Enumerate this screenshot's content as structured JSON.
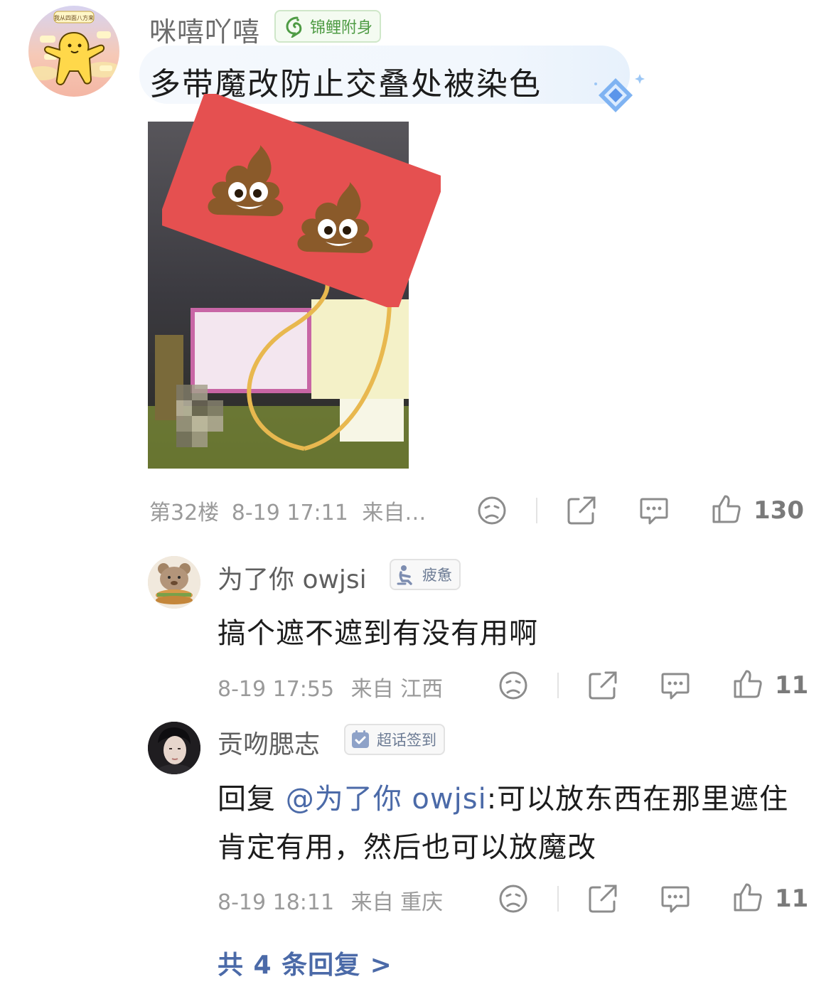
{
  "main_comment": {
    "username": "咪嘻吖嘻",
    "badge": "锦鲤附身",
    "avatar_text": "我从四面八方来",
    "text": "多带魔改防止交叠处被染色",
    "floor": "第32楼",
    "time": "8-19 17:11",
    "source": "来自…",
    "likes": "130"
  },
  "replies": [
    {
      "username": "为了你 owjsi",
      "badge": "疲惫",
      "text": "搞个遮不遮到有没有用啊",
      "time": "8-19 17:55",
      "location": "来自 江西",
      "likes": "11"
    },
    {
      "username": "贡吻腮志",
      "badge": "超话签到",
      "reply_prefix": "回复 ",
      "mention": "@为了你 owjsi",
      "text": ":可以放东西在那里遮住肯定有用，然后也可以放魔改",
      "time": "8-19 18:11",
      "location": "来自 重庆",
      "likes": "11"
    }
  ],
  "more_replies": "共 4 条回复 >",
  "colors": {
    "link": "#4b6aa8",
    "meta": "#9a9a9a",
    "koi_badge": "#4e9b44",
    "sticker_red": "#e55050"
  },
  "icons": [
    "dislike-icon",
    "share-icon",
    "comment-icon",
    "like-icon",
    "fish-icon",
    "tired-person-icon",
    "calendar-check-icon",
    "diamond-icon",
    "poop-emoji"
  ]
}
